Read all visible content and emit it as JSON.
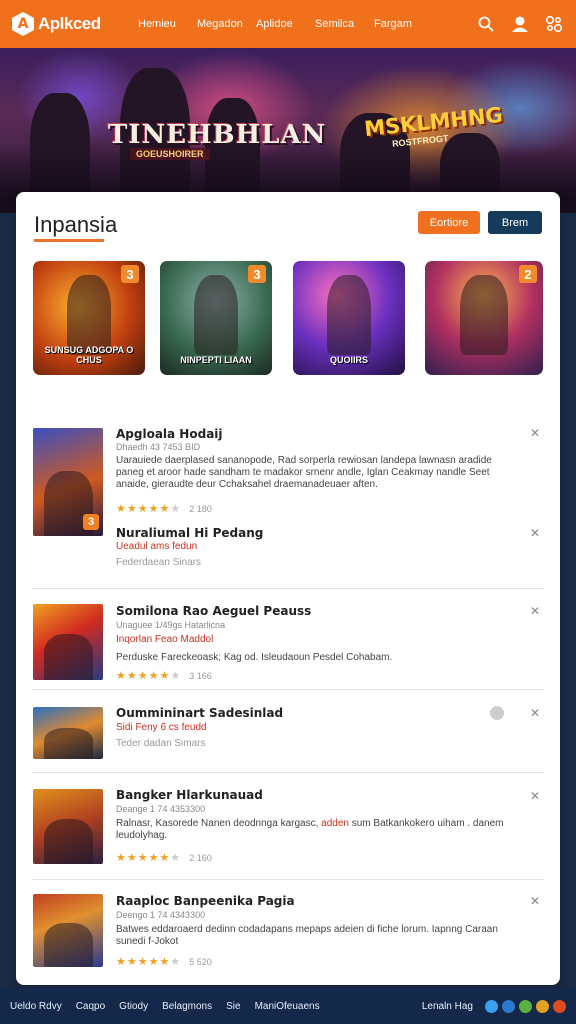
{
  "header": {
    "logo_text": "Aplkced",
    "nav": [
      "Hemieu",
      "Megadon",
      "Aplidoe",
      "Semilca",
      "Fargam"
    ]
  },
  "hero": {
    "title_left": "TINEHBHLAN",
    "sub_left": "GOEUSHOIRER",
    "title_right": "MSKLMHNG",
    "sub_right": "ROSTFROGT"
  },
  "card": {
    "title": "Inpansia",
    "btn_primary": "Eortiore",
    "btn_secondary": "Brem"
  },
  "tiles": [
    {
      "badge": "3",
      "caption": "SUNSUG ADGOPA O CHUS"
    },
    {
      "badge": "3",
      "caption": "NINPEPTI LIAAN"
    },
    {
      "badge": "",
      "caption": "QUOIIRS"
    },
    {
      "badge": "2",
      "caption": ""
    }
  ],
  "list": [
    {
      "title": "Apgloala Hodaij",
      "meta": "Dhaedh 43 7453 BID",
      "desc": "Uarauiede daerplased sananopode, Rad sorperla rewiosan landepa lawnasn aradide paneg et aroor hade sandham te madakor srnenr andle, Iglan Ceakmay nandle Seet anaide, gieraudte deur Cchaksahel draemanadeuaer aften.",
      "rating": "2 180",
      "thumb_badge": "3"
    },
    {
      "title": "Nuraliumal Hi Pedang",
      "red": "Ueadul ams fedun",
      "sub": "Federdaean Sinars"
    },
    {
      "title": "Somilona Rao Aeguel Peauss",
      "meta": "Unaguee 1/49gs Hatarlicna",
      "red": "Inqorlan Feao Maddol",
      "desc": "Perduske Fareckeoask; Kag od. Isleudaoun Pesdel Cohabam.",
      "rating": "3 166"
    },
    {
      "title": "Oummininart Sadesinlad",
      "red": "Sidi Feny 6 cs feudd",
      "sub": "Teder dadan Simars"
    },
    {
      "title": "Bangker Hlarkunauad",
      "meta": "Deange 1 74 4353300",
      "desc_a": "Ralnasr, Kasorede Nanen deodnnga kargasc,",
      "desc_hl": "adden",
      "desc_b": "sum Batkankokero uiham . danem leudolyhag.",
      "rating": "2 160"
    },
    {
      "title": "Raaploc Banpeenika Pagia",
      "meta": "Deengo 1 74 4343300",
      "desc": "Batwes eddaroaerd dedinn codadapans mepaps adeien di fiche lorum. Iapnng Caraan sunedi f-Jokot",
      "rating": "5 520"
    }
  ],
  "footer": {
    "links": [
      "Ueldo Rdvy",
      "Caqpo",
      "Gtiody",
      "Belagmons",
      "Sie",
      "ManiOfeuaens"
    ],
    "right_label": "Lenaln Hag"
  },
  "colors": {
    "brand_orange": "#f0701c",
    "navy": "#14284a",
    "star": "#f0a020",
    "accent_red": "#c8301e"
  }
}
